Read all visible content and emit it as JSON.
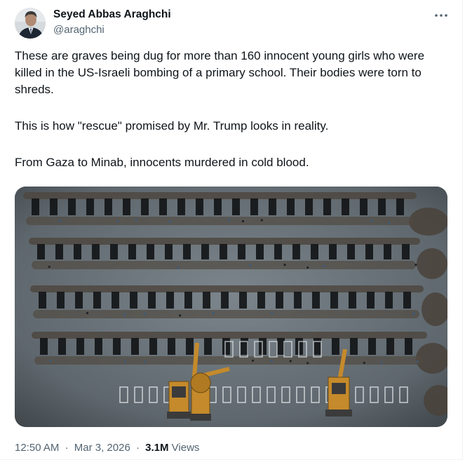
{
  "author": {
    "name": "Seyed Abbas Araghchi",
    "handle": "@araghchi"
  },
  "tweet": {
    "paragraphs": [
      "These are graves being dug for more than 160 innocent young girls who were killed in the US-Israeli bombing of a primary school. Their bodies were torn to shreds.",
      "This is how \"rescue\" promised by Mr. Trump looks in reality.",
      "From Gaza to Minab, innocents murdered in cold blood."
    ]
  },
  "meta": {
    "time": "12:50 AM",
    "separator": "·",
    "date": "Mar 3, 2026",
    "views_count": "3.1M",
    "views_label": "Views"
  },
  "icons": {
    "more": "more-horizontal-icon"
  },
  "colors": {
    "text": "#0f1419",
    "secondary": "#536471",
    "border": "#eff3f4",
    "photo_ground": "#616a70",
    "excavator": "#c58a2b"
  }
}
